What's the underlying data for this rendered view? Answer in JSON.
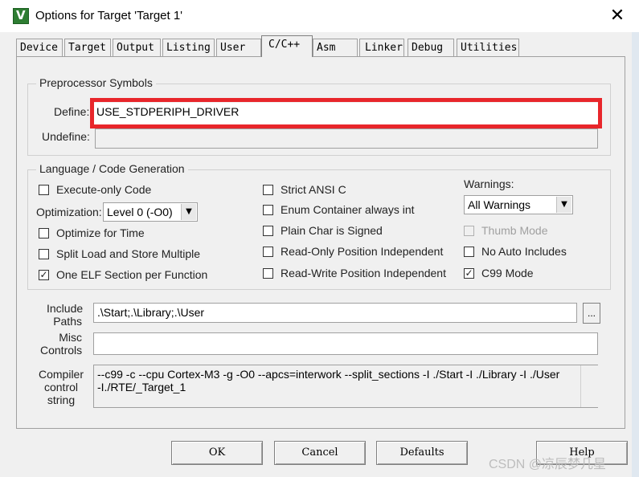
{
  "window": {
    "title": "Options for Target 'Target 1'",
    "icon_letter": "V",
    "close_glyph": "✕"
  },
  "tabs": [
    {
      "label": "Device"
    },
    {
      "label": "Target"
    },
    {
      "label": "Output"
    },
    {
      "label": "Listing"
    },
    {
      "label": "User"
    },
    {
      "label": "C/C++",
      "active": true
    },
    {
      "label": "Asm"
    },
    {
      "label": "Linker"
    },
    {
      "label": "Debug"
    },
    {
      "label": "Utilities"
    }
  ],
  "preprocessor": {
    "group_title": "Preprocessor Symbols",
    "define_label": "Define:",
    "define_value": "USE_STDPERIPH_DRIVER",
    "undefine_label": "Undefine:",
    "undefine_value": ""
  },
  "language": {
    "group_title": "Language / Code Generation",
    "execute_only_code": {
      "label": "Execute-only Code",
      "checked": false
    },
    "optimization_label": "Optimization:",
    "optimization_value": "Level 0 (-O0)",
    "optimize_for_time": {
      "label": "Optimize for Time",
      "checked": false
    },
    "split_load_store": {
      "label": "Split Load and Store Multiple",
      "checked": false
    },
    "one_elf_section": {
      "label": "One ELF Section per Function",
      "checked": true
    },
    "strict_ansi_c": {
      "label": "Strict ANSI C",
      "checked": false
    },
    "enum_container": {
      "label": "Enum Container always int",
      "checked": false
    },
    "plain_char_signed": {
      "label": "Plain Char is Signed",
      "checked": false
    },
    "ro_position_independent": {
      "label": "Read-Only Position Independent",
      "checked": false
    },
    "rw_position_independent": {
      "label": "Read-Write Position Independent",
      "checked": false
    },
    "warnings_label": "Warnings:",
    "warnings_value": "All Warnings",
    "thumb_mode": {
      "label": "Thumb Mode",
      "checked": false,
      "disabled": true
    },
    "no_auto_includes": {
      "label": "No Auto Includes",
      "checked": false
    },
    "c99_mode": {
      "label": "C99 Mode",
      "checked": true
    }
  },
  "paths": {
    "include_label_1": "Include",
    "include_label_2": "Paths",
    "include_value": ".\\Start;.\\Library;.\\User",
    "browse_label": "...",
    "misc_label_1": "Misc",
    "misc_label_2": "Controls",
    "misc_value": "",
    "compiler_label_1": "Compiler",
    "compiler_label_2": "control",
    "compiler_label_3": "string",
    "compiler_value": "--c99 -c --cpu Cortex-M3 -g -O0 --apcs=interwork --split_sections -I ./Start -I ./Library -I ./User\n-I./RTE/_Target_1"
  },
  "buttons": {
    "ok": "OK",
    "cancel": "Cancel",
    "defaults": "Defaults",
    "help": "Help"
  },
  "watermark": "CSDN @凉辰梦几星",
  "colors": {
    "highlight_border": "#e8262b",
    "dialog_bg": "#f0f0f0"
  }
}
